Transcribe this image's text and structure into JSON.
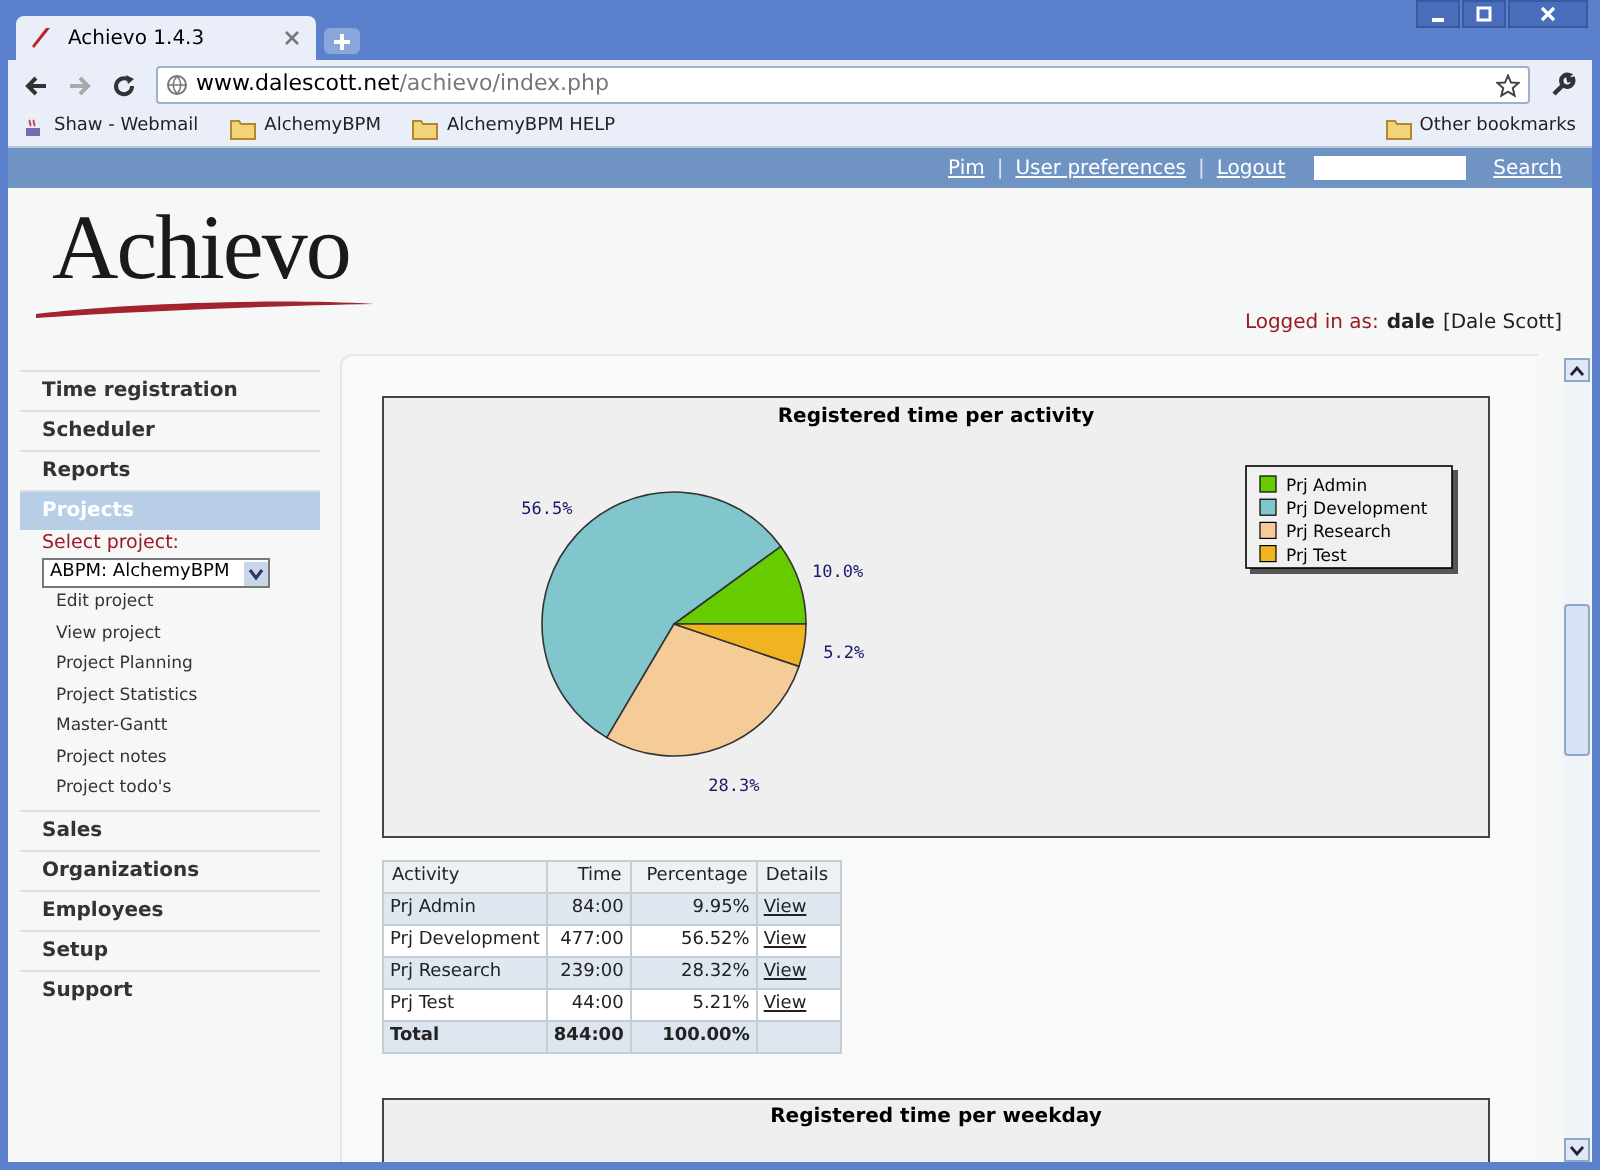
{
  "browser": {
    "tab_title": "Achievo 1.4.3",
    "url_host": "www.dalescott.net",
    "url_path": "/achievo/index.php",
    "bookmarks": [
      {
        "label": "Shaw - Webmail",
        "kind": "site"
      },
      {
        "label": "AlchemyBPM",
        "kind": "folder"
      },
      {
        "label": "AlchemyBPM HELP",
        "kind": "folder"
      }
    ],
    "other_bookmarks": "Other bookmarks"
  },
  "header": {
    "links": [
      "Pim",
      "User preferences",
      "Logout"
    ],
    "separators": [
      "|",
      "|"
    ],
    "search_button": "Search"
  },
  "logo": "Achievo",
  "login": {
    "label": "Logged in as:",
    "user": "dale",
    "full_name": "[Dale Scott]"
  },
  "sidebar": {
    "items": [
      {
        "label": "Time registration",
        "selected": false
      },
      {
        "label": "Scheduler",
        "selected": false
      },
      {
        "label": "Reports",
        "selected": false
      },
      {
        "label": "Projects",
        "selected": true,
        "select_label": "Select project:",
        "select_value": "ABPM: AlchemyBPM",
        "children": [
          "Edit project",
          "View project",
          "Project Planning",
          "Project Statistics",
          "Master-Gantt",
          "Project notes",
          "Project todo's"
        ]
      },
      {
        "label": "Sales",
        "selected": false
      },
      {
        "label": "Organizations",
        "selected": false
      },
      {
        "label": "Employees",
        "selected": false
      },
      {
        "label": "Setup",
        "selected": false
      },
      {
        "label": "Support",
        "selected": false
      }
    ]
  },
  "activity_chart": {
    "chart_data": {
      "type": "pie",
      "title": "Registered time per activity",
      "categories": [
        "Prj Admin",
        "Prj Development",
        "Prj Research",
        "Prj Test"
      ],
      "values": [
        10.0,
        56.5,
        28.3,
        5.2
      ],
      "value_labels": [
        "10.0%",
        "56.5%",
        "28.3%",
        "5.2%"
      ],
      "legend": "right"
    },
    "slices": [
      {
        "color": "#66cc00"
      },
      {
        "color": "#80c6cc"
      },
      {
        "color": "#f5cb98"
      },
      {
        "color": "#f0b420"
      }
    ]
  },
  "table": {
    "columns": [
      "Activity",
      "Time",
      "Percentage",
      "Details"
    ],
    "rows": [
      {
        "kind": "data",
        "cells": [
          "Prj Admin",
          "84:00",
          "9.95%",
          "View"
        ]
      },
      {
        "kind": "data",
        "cells": [
          "Prj Development",
          "477:00",
          "56.52%",
          "View"
        ]
      },
      {
        "kind": "data",
        "cells": [
          "Prj Research",
          "239:00",
          "28.32%",
          "View"
        ]
      },
      {
        "kind": "data",
        "cells": [
          "Prj Test",
          "44:00",
          "5.21%",
          "View"
        ]
      },
      {
        "kind": "total",
        "cells": [
          "Total",
          "844:00",
          "100.00%"
        ]
      }
    ]
  },
  "weekday_chart": {
    "title": "Registered time per weekday"
  }
}
